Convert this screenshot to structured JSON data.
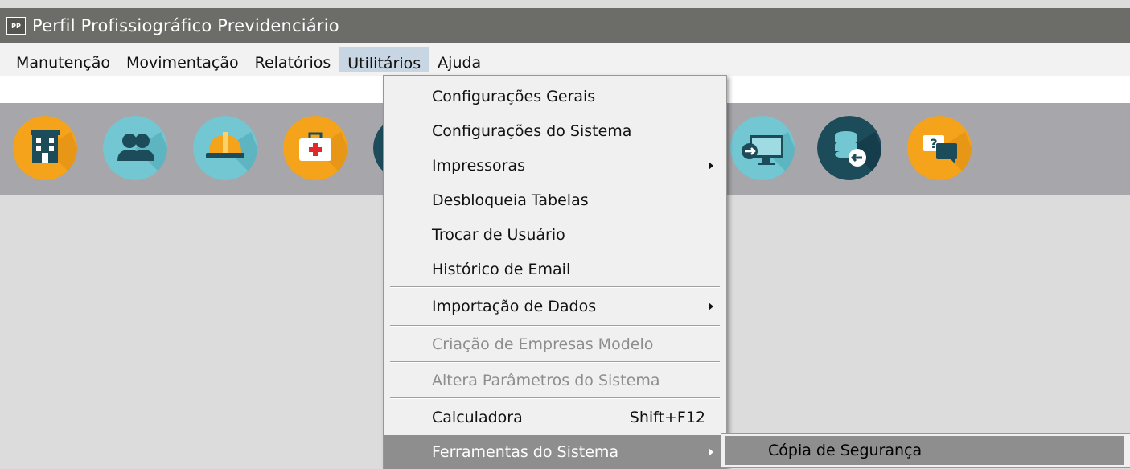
{
  "window": {
    "icon_text": "PP",
    "title": "Perfil Profissiográfico Previdenciário"
  },
  "menubar": [
    {
      "label": "Manutenção"
    },
    {
      "label": "Movimentação"
    },
    {
      "label": "Relatórios"
    },
    {
      "label": "Utilitários",
      "active": true
    },
    {
      "label": "Ajuda"
    }
  ],
  "toolbar": {
    "icons": [
      "company-building-icon",
      "employees-icon",
      "safety-helmet-icon",
      "medical-kit-icon",
      "hidden-icon",
      "remote-screen-icon",
      "database-restore-icon",
      "help-chat-icon"
    ],
    "colors": {
      "orange": "#f4a31b",
      "teal": "#72c7d2",
      "dark": "#1c4b5a"
    }
  },
  "utilitarios_menu": {
    "items": [
      {
        "label": "Configurações Gerais"
      },
      {
        "label": "Configurações do Sistema"
      },
      {
        "label": "Impressoras",
        "submenu": true
      },
      {
        "label": "Desbloqueia Tabelas"
      },
      {
        "label": "Trocar de Usuário"
      },
      {
        "label": "Histórico de Email"
      },
      {
        "label": "Importação de Dados",
        "submenu": true
      },
      {
        "label": "Criação de Empresas Modelo",
        "disabled": true
      },
      {
        "label": "Altera Parâmetros do Sistema",
        "disabled": true
      },
      {
        "label": "Calculadora",
        "shortcut": "Shift+F12"
      },
      {
        "label": "Ferramentas do Sistema",
        "submenu": true,
        "highlighted": true
      }
    ]
  },
  "ferramentas_submenu": {
    "items": [
      {
        "label": "Cópia de Segurança",
        "highlighted": true
      }
    ]
  }
}
